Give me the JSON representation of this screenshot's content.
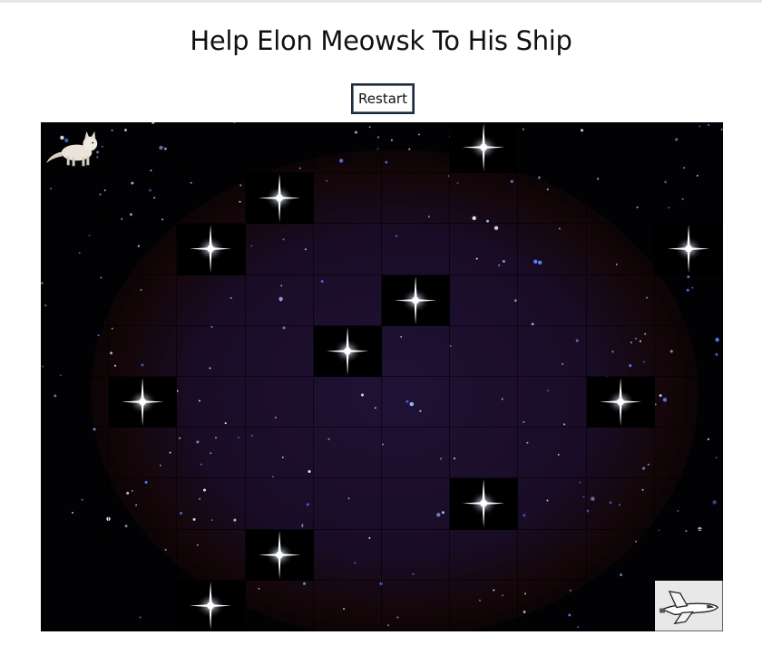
{
  "title": "Help Elon Meowsk To His Ship",
  "restart_label": "Restart",
  "board": {
    "rows": 10,
    "cols": 10,
    "player": {
      "row": 0,
      "col": 0,
      "icon": "cat-icon"
    },
    "goal": {
      "row": 9,
      "col": 9,
      "icon": "space-shuttle-icon"
    },
    "obstacles": [
      {
        "row": 0,
        "col": 6
      },
      {
        "row": 1,
        "col": 3
      },
      {
        "row": 2,
        "col": 2
      },
      {
        "row": 2,
        "col": 9
      },
      {
        "row": 3,
        "col": 5
      },
      {
        "row": 4,
        "col": 4
      },
      {
        "row": 5,
        "col": 1
      },
      {
        "row": 5,
        "col": 8
      },
      {
        "row": 7,
        "col": 6
      },
      {
        "row": 8,
        "col": 3
      },
      {
        "row": 9,
        "col": 2
      }
    ],
    "obstacle_icon": "bright-star-icon",
    "colors": {
      "space": "#020103",
      "nebula": "#1d0e2a",
      "star_cell": "#000000"
    }
  }
}
